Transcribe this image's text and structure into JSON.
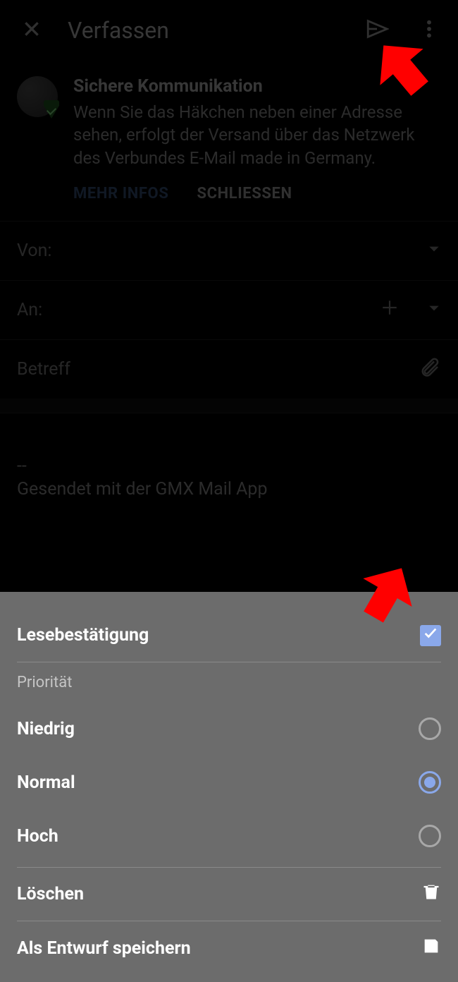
{
  "appbar": {
    "title": "Verfassen"
  },
  "info": {
    "title": "Sichere Kommunikation",
    "body": "Wenn Sie das Häkchen neben einer Adresse sehen, erfolgt der Versand über das Netzwerk des Verbundes E-Mail made in Germany.",
    "more": "MEHR INFOS",
    "close": "SCHLIESSEN"
  },
  "fields": {
    "from": "Von:",
    "to": "An:",
    "subject": "Betreff"
  },
  "body": {
    "sep": "--",
    "signature": "Gesendet mit der GMX Mail App"
  },
  "sheet": {
    "readReceipt": "Lesebestätigung",
    "priorityHeader": "Priorität",
    "priority": {
      "low": "Niedrig",
      "normal": "Normal",
      "high": "Hoch",
      "selected": "normal"
    },
    "delete": "Löschen",
    "saveDraft": "Als Entwurf speichern"
  }
}
